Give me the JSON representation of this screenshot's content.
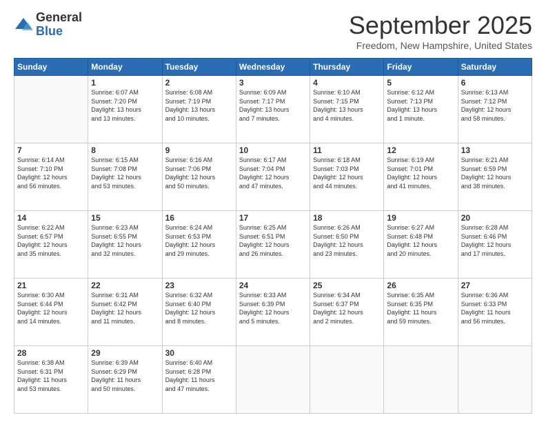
{
  "logo": {
    "general": "General",
    "blue": "Blue"
  },
  "header": {
    "month": "September 2025",
    "location": "Freedom, New Hampshire, United States"
  },
  "days": [
    "Sunday",
    "Monday",
    "Tuesday",
    "Wednesday",
    "Thursday",
    "Friday",
    "Saturday"
  ],
  "weeks": [
    [
      {
        "day": "",
        "content": ""
      },
      {
        "day": "1",
        "content": "Sunrise: 6:07 AM\nSunset: 7:20 PM\nDaylight: 13 hours\nand 13 minutes."
      },
      {
        "day": "2",
        "content": "Sunrise: 6:08 AM\nSunset: 7:19 PM\nDaylight: 13 hours\nand 10 minutes."
      },
      {
        "day": "3",
        "content": "Sunrise: 6:09 AM\nSunset: 7:17 PM\nDaylight: 13 hours\nand 7 minutes."
      },
      {
        "day": "4",
        "content": "Sunrise: 6:10 AM\nSunset: 7:15 PM\nDaylight: 13 hours\nand 4 minutes."
      },
      {
        "day": "5",
        "content": "Sunrise: 6:12 AM\nSunset: 7:13 PM\nDaylight: 13 hours\nand 1 minute."
      },
      {
        "day": "6",
        "content": "Sunrise: 6:13 AM\nSunset: 7:12 PM\nDaylight: 12 hours\nand 58 minutes."
      }
    ],
    [
      {
        "day": "7",
        "content": "Sunrise: 6:14 AM\nSunset: 7:10 PM\nDaylight: 12 hours\nand 56 minutes."
      },
      {
        "day": "8",
        "content": "Sunrise: 6:15 AM\nSunset: 7:08 PM\nDaylight: 12 hours\nand 53 minutes."
      },
      {
        "day": "9",
        "content": "Sunrise: 6:16 AM\nSunset: 7:06 PM\nDaylight: 12 hours\nand 50 minutes."
      },
      {
        "day": "10",
        "content": "Sunrise: 6:17 AM\nSunset: 7:04 PM\nDaylight: 12 hours\nand 47 minutes."
      },
      {
        "day": "11",
        "content": "Sunrise: 6:18 AM\nSunset: 7:03 PM\nDaylight: 12 hours\nand 44 minutes."
      },
      {
        "day": "12",
        "content": "Sunrise: 6:19 AM\nSunset: 7:01 PM\nDaylight: 12 hours\nand 41 minutes."
      },
      {
        "day": "13",
        "content": "Sunrise: 6:21 AM\nSunset: 6:59 PM\nDaylight: 12 hours\nand 38 minutes."
      }
    ],
    [
      {
        "day": "14",
        "content": "Sunrise: 6:22 AM\nSunset: 6:57 PM\nDaylight: 12 hours\nand 35 minutes."
      },
      {
        "day": "15",
        "content": "Sunrise: 6:23 AM\nSunset: 6:55 PM\nDaylight: 12 hours\nand 32 minutes."
      },
      {
        "day": "16",
        "content": "Sunrise: 6:24 AM\nSunset: 6:53 PM\nDaylight: 12 hours\nand 29 minutes."
      },
      {
        "day": "17",
        "content": "Sunrise: 6:25 AM\nSunset: 6:51 PM\nDaylight: 12 hours\nand 26 minutes."
      },
      {
        "day": "18",
        "content": "Sunrise: 6:26 AM\nSunset: 6:50 PM\nDaylight: 12 hours\nand 23 minutes."
      },
      {
        "day": "19",
        "content": "Sunrise: 6:27 AM\nSunset: 6:48 PM\nDaylight: 12 hours\nand 20 minutes."
      },
      {
        "day": "20",
        "content": "Sunrise: 6:28 AM\nSunset: 6:46 PM\nDaylight: 12 hours\nand 17 minutes."
      }
    ],
    [
      {
        "day": "21",
        "content": "Sunrise: 6:30 AM\nSunset: 6:44 PM\nDaylight: 12 hours\nand 14 minutes."
      },
      {
        "day": "22",
        "content": "Sunrise: 6:31 AM\nSunset: 6:42 PM\nDaylight: 12 hours\nand 11 minutes."
      },
      {
        "day": "23",
        "content": "Sunrise: 6:32 AM\nSunset: 6:40 PM\nDaylight: 12 hours\nand 8 minutes."
      },
      {
        "day": "24",
        "content": "Sunrise: 6:33 AM\nSunset: 6:39 PM\nDaylight: 12 hours\nand 5 minutes."
      },
      {
        "day": "25",
        "content": "Sunrise: 6:34 AM\nSunset: 6:37 PM\nDaylight: 12 hours\nand 2 minutes."
      },
      {
        "day": "26",
        "content": "Sunrise: 6:35 AM\nSunset: 6:35 PM\nDaylight: 11 hours\nand 59 minutes."
      },
      {
        "day": "27",
        "content": "Sunrise: 6:36 AM\nSunset: 6:33 PM\nDaylight: 11 hours\nand 56 minutes."
      }
    ],
    [
      {
        "day": "28",
        "content": "Sunrise: 6:38 AM\nSunset: 6:31 PM\nDaylight: 11 hours\nand 53 minutes."
      },
      {
        "day": "29",
        "content": "Sunrise: 6:39 AM\nSunset: 6:29 PM\nDaylight: 11 hours\nand 50 minutes."
      },
      {
        "day": "30",
        "content": "Sunrise: 6:40 AM\nSunset: 6:28 PM\nDaylight: 11 hours\nand 47 minutes."
      },
      {
        "day": "",
        "content": ""
      },
      {
        "day": "",
        "content": ""
      },
      {
        "day": "",
        "content": ""
      },
      {
        "day": "",
        "content": ""
      }
    ]
  ]
}
